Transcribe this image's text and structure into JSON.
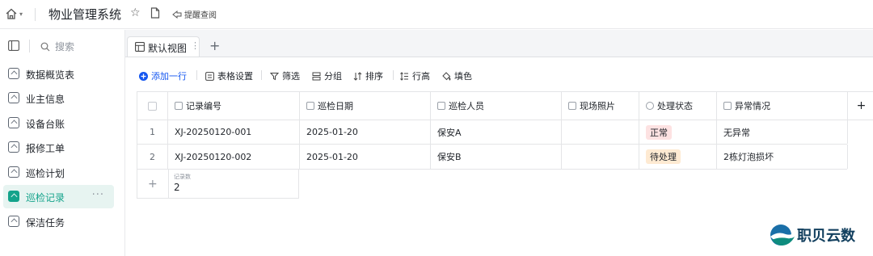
{
  "app": {
    "title": "物业管理系统",
    "reminder_label": "提醒查阅"
  },
  "sidebar": {
    "search_placeholder": "搜索",
    "items": [
      {
        "label": "数据概览表"
      },
      {
        "label": "业主信息"
      },
      {
        "label": "设备台账"
      },
      {
        "label": "报修工单"
      },
      {
        "label": "巡检计划"
      },
      {
        "label": "巡检记录",
        "active": true
      },
      {
        "label": "保洁任务"
      }
    ],
    "more_label": "···"
  },
  "view": {
    "tab_label": "默认视图",
    "add_symbol": "+"
  },
  "toolbar": {
    "add_row": "添加一行",
    "table_settings": "表格设置",
    "filter": "筛选",
    "group": "分组",
    "sort": "排序",
    "row_height": "行高",
    "fill_color": "填色"
  },
  "table": {
    "columns": [
      "记录编号",
      "巡检日期",
      "巡检人员",
      "现场照片",
      "处理状态",
      "异常情况"
    ],
    "rows": [
      {
        "num": "1",
        "id": "XJ-20250120-001",
        "date": "2025-01-20",
        "staff": "保安A",
        "photo": "",
        "status": "正常",
        "issue": "无异常"
      },
      {
        "num": "2",
        "id": "XJ-20250120-002",
        "date": "2025-01-20",
        "staff": "保安B",
        "photo": "",
        "status": "待处理",
        "issue": "2栋灯泡损坏"
      }
    ],
    "footer_label": "记录数",
    "footer_count": "2",
    "add_symbol": "+"
  },
  "watermark": {
    "text": "职贝云数"
  },
  "colors": {
    "accent": "#14a38b",
    "primary": "#1456f0",
    "status_ok": "#fde2e2",
    "status_pending": "#feead2"
  }
}
